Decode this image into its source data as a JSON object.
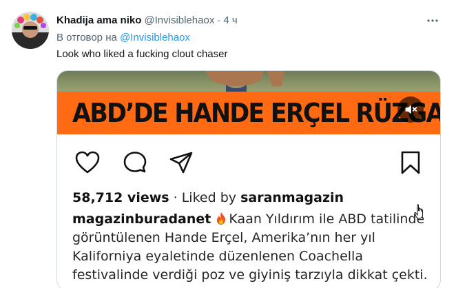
{
  "tweet": {
    "display_name": "Khadija ama niko",
    "handle": "@Invisiblehaox",
    "separator": "·",
    "time": "4 ч",
    "reply_prefix": "В отговор на",
    "reply_handle": "@Invisiblehaox",
    "text": "Look who liked a fucking clout chaser"
  },
  "media": {
    "banner_text": "ABD’DE HANDE ERÇEL RÜZGARI",
    "views_label": "58,712 views",
    "liked_by_prefix": "· Liked by",
    "liked_by_user": "saranmagazin",
    "caption_user": "magazinburadanet",
    "caption_lines": [
      "Kaan Yıldırım ile ABD tatilinde",
      "görüntülenen Hande Erçel, Amerika’nın her yıl",
      "Kaliforniya eyaletinde düzenlenen Coachella",
      "festivalinde verdiği poz ve giyiniş tarzıyla dikkat çekti."
    ]
  },
  "icons": {
    "more": "more-horizontal-icon",
    "mute": "volume-muted-icon",
    "like": "heart-icon",
    "comment": "comment-bubble-icon",
    "share": "send-paper-plane-icon",
    "save": "bookmark-icon",
    "fire": "fire-emoji-icon"
  },
  "colors": {
    "link_blue": "#1d9bf0",
    "banner_orange": "#ff6a13",
    "muted_text": "#536471"
  }
}
